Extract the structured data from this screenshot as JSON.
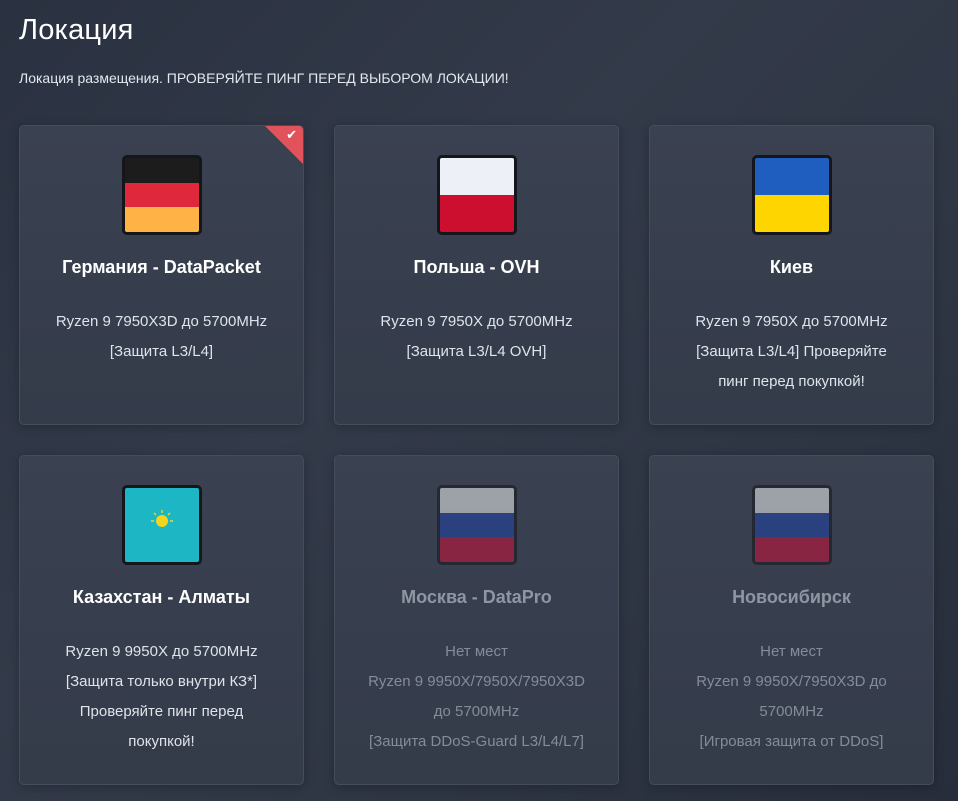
{
  "header": {
    "title": "Локация",
    "subtitle": "Локация размещения. ПРОВЕРЯЙТЕ ПИНГ ПЕРЕД ВЫБОРОМ ЛОКАЦИИ!"
  },
  "locations": [
    {
      "title": "Германия - DataPacket",
      "lines": [
        "Ryzen 9 7950X3D до 5700MHz",
        "[Защита L3/L4]"
      ],
      "flag_icon": "germany-flag-icon",
      "flag_colors": [
        "#1c1c1c",
        "#e0283d",
        "#ffb347"
      ],
      "selected": true,
      "available": true
    },
    {
      "title": "Польша - OVH",
      "lines": [
        "Ryzen 9 7950X до 5700MHz",
        "[Защита L3/L4 OVH]"
      ],
      "flag_icon": "poland-flag-icon",
      "flag_colors": [
        "#edf0f6",
        "#cc0f2e"
      ],
      "selected": false,
      "available": true
    },
    {
      "title": "Киев",
      "lines": [
        "Ryzen 9 7950X до 5700MHz",
        "[Защита L3/L4] Проверяйте",
        "пинг перед покупкой!"
      ],
      "flag_icon": "ukraine-flag-icon",
      "flag_colors": [
        "#1f5dbf",
        "#ffd500"
      ],
      "selected": false,
      "available": true
    },
    {
      "title": "Казахстан - Алматы",
      "lines": [
        "Ryzen 9 9950X до 5700MHz",
        "[Защита только внутри КЗ*]",
        "Проверяйте пинг перед",
        "покупкой!"
      ],
      "flag_icon": "kazakhstan-flag-icon",
      "flag_colors": [
        "#1cb6c4",
        "#f4d51e"
      ],
      "selected": false,
      "available": true
    },
    {
      "title": "Москва - DataPro",
      "lines": [
        "Нет мест",
        "Ryzen 9 9950X/7950X/7950X3D",
        "до 5700MHz",
        "[Защита DDoS-Guard L3/L4/L7]"
      ],
      "flag_icon": "russia-flag-icon",
      "flag_colors": [
        "#f0f0f0",
        "#2043a8",
        "#c8103a"
      ],
      "selected": false,
      "available": false
    },
    {
      "title": "Новосибирск",
      "lines": [
        "Нет мест",
        "Ryzen 9 9950X/7950X3D до",
        "5700MHz",
        "[Игровая защита от DDoS]"
      ],
      "flag_icon": "russia-flag-icon",
      "flag_colors": [
        "#f0f0f0",
        "#2043a8",
        "#c8103a"
      ],
      "selected": false,
      "available": false
    }
  ]
}
